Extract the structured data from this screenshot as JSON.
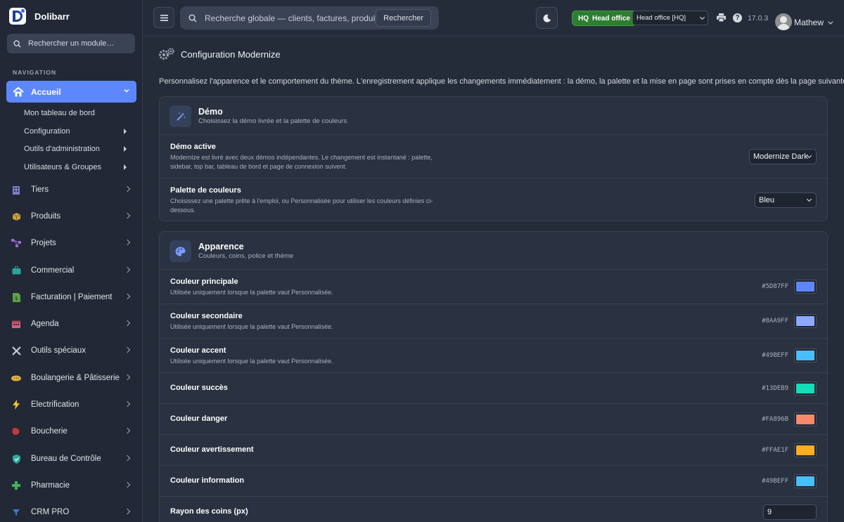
{
  "brand": {
    "name": "Dolibarr"
  },
  "sidebar": {
    "search_placeholder": "Rechercher un module…",
    "nav_title": "NAVIGATION",
    "active": {
      "label": "Accueil",
      "icon": "home-icon"
    },
    "subitems": [
      {
        "label": "Mon tableau de bord",
        "arrow": false
      },
      {
        "label": "Configuration",
        "arrow": true
      },
      {
        "label": "Outils d'administration",
        "arrow": true
      },
      {
        "label": "Utilisateurs & Groupes",
        "arrow": true
      }
    ],
    "items": [
      {
        "label": "Tiers",
        "icon": "building-icon",
        "color": "#7c7ec9"
      },
      {
        "label": "Produits",
        "icon": "box-icon",
        "color": "#c9a23c"
      },
      {
        "label": "Projets",
        "icon": "project-icon",
        "color": "#9b6ad1"
      },
      {
        "label": "Commercial",
        "icon": "briefcase-icon",
        "color": "#2aa39a"
      },
      {
        "label": "Facturation | Paiement",
        "icon": "invoice-icon",
        "color": "#5aa342"
      },
      {
        "label": "Agenda",
        "icon": "calendar-icon",
        "color": "#d4607a"
      },
      {
        "label": "Outils spéciaux",
        "icon": "tools-icon",
        "color": "#c8ccd6"
      },
      {
        "label": "Boulangerie & Pâtisserie",
        "icon": "bread-icon",
        "color": "#e1b24a"
      },
      {
        "label": "Electrification",
        "icon": "bolt-icon",
        "color": "#f2c230"
      },
      {
        "label": "Boucherie",
        "icon": "meat-icon",
        "color": "#c43a3a"
      },
      {
        "label": "Bureau de Contrôle",
        "icon": "shield-icon",
        "color": "#2fa7a0"
      },
      {
        "label": "Pharmacie",
        "icon": "cross-icon",
        "color": "#3fb25a"
      },
      {
        "label": "CRM PRO",
        "icon": "funnel-icon",
        "color": "#3a7bd5"
      }
    ]
  },
  "topbar": {
    "search_placeholder": "Recherche globale — clients, factures, produits…",
    "search_button": "Rechercher",
    "hq_code": "HQ",
    "hq_label": "Head office",
    "entity_value": "Head office [HQ]",
    "version": "17.0.3",
    "user": "Mathew"
  },
  "page": {
    "title": "Configuration Modernize",
    "description": "Personnalisez l'apparence et le comportement du thème. L'enregistrement applique les changements immédiatement : la démo, la palette et la mise en page sont prises en compte dès la page suivante."
  },
  "demo_card": {
    "title": "Démo",
    "subtitle": "Choisissez la démo livrée et la palette de couleurs",
    "rows": [
      {
        "label": "Démo active",
        "desc": "Modernize est livré avec deux démos indépendantes. Le changement est instantané : palette, sidebar, top bar, tableau de bord et page de connexion suivent.",
        "value": "Modernize Dark"
      },
      {
        "label": "Palette de couleurs",
        "desc": "Choisissez une palette prête à l'emploi, ou Personnalisée pour utiliser les couleurs définies ci-dessous.",
        "value": "Bleu"
      }
    ]
  },
  "appearance_card": {
    "title": "Apparence",
    "subtitle": "Couleurs, coins, police et thème",
    "colors": [
      {
        "label": "Couleur principale",
        "desc": "Utilisée uniquement lorsque la palette vaut Personnalisée.",
        "hex": "#5D87FF",
        "color": "#5D87FF"
      },
      {
        "label": "Couleur secondaire",
        "desc": "Utilisée uniquement lorsque la palette vaut Personnalisée.",
        "hex": "#8AA9FF",
        "color": "#8AA9FF"
      },
      {
        "label": "Couleur accent",
        "desc": "Utilisée uniquement lorsque la palette vaut Personnalisée.",
        "hex": "#49BEFF",
        "color": "#49BEFF"
      },
      {
        "label": "Couleur succès",
        "desc": "",
        "hex": "#13DEB9",
        "color": "#13DEB9"
      },
      {
        "label": "Couleur danger",
        "desc": "",
        "hex": "#FA896B",
        "color": "#FA896B"
      },
      {
        "label": "Couleur avertissement",
        "desc": "",
        "hex": "#FFAE1F",
        "color": "#FFAE1F"
      },
      {
        "label": "Couleur information",
        "desc": "",
        "hex": "#49BEFF",
        "color": "#49BEFF"
      }
    ],
    "radius": {
      "label": "Rayon des coins (px)",
      "value": "9"
    }
  }
}
